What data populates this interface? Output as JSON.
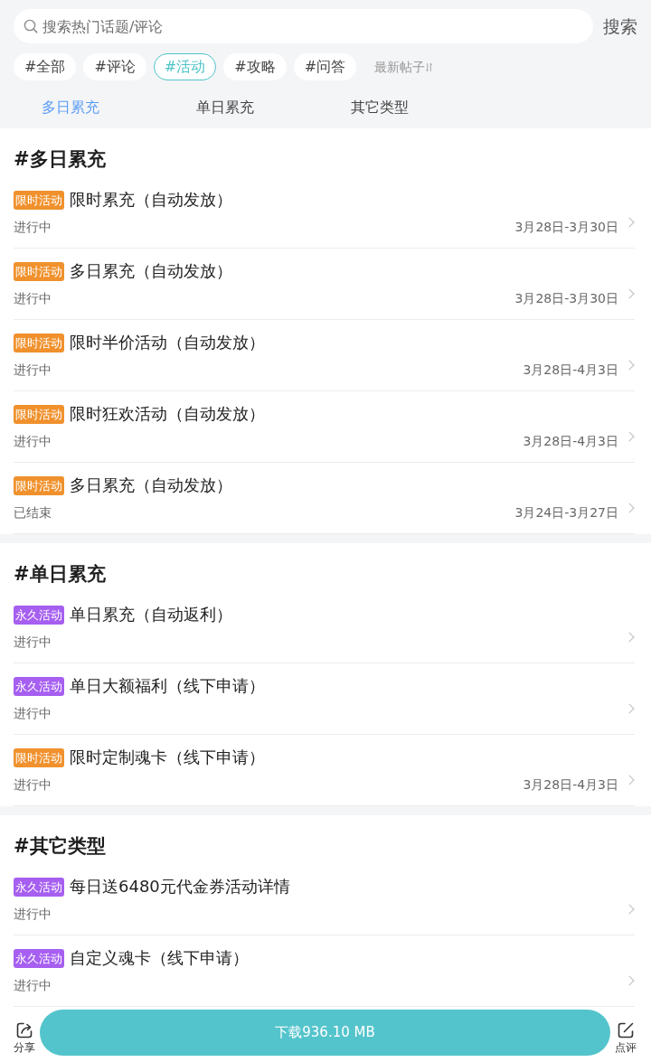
{
  "search": {
    "placeholder": "搜索热门话题/评论",
    "button": "搜索"
  },
  "filters": [
    {
      "label": "#全部",
      "selected": false
    },
    {
      "label": "#评论",
      "selected": false
    },
    {
      "label": "#活动",
      "selected": true
    },
    {
      "label": "#攻略",
      "selected": false
    },
    {
      "label": "#问答",
      "selected": false
    }
  ],
  "sort": {
    "label": "最新帖子"
  },
  "tabs": [
    {
      "label": "多日累充",
      "selected": true
    },
    {
      "label": "单日累充",
      "selected": false
    },
    {
      "label": "其它类型",
      "selected": false
    }
  ],
  "sections": [
    {
      "title": "#多日累充",
      "items": [
        {
          "tag": {
            "label": "限时活动",
            "color": "#f0912d"
          },
          "title": "限时累充（自动发放）",
          "status": "进行中",
          "dates": "3月28日-3月30日"
        },
        {
          "tag": {
            "label": "限时活动",
            "color": "#f0912d"
          },
          "title": "多日累充（自动发放）",
          "status": "进行中",
          "dates": "3月28日-3月30日"
        },
        {
          "tag": {
            "label": "限时活动",
            "color": "#f0912d"
          },
          "title": "限时半价活动（自动发放）",
          "status": "进行中",
          "dates": "3月28日-4月3日"
        },
        {
          "tag": {
            "label": "限时活动",
            "color": "#f0912d"
          },
          "title": "限时狂欢活动（自动发放）",
          "status": "进行中",
          "dates": "3月28日-4月3日"
        },
        {
          "tag": {
            "label": "限时活动",
            "color": "#f0912d"
          },
          "title": "多日累充（自动发放）",
          "status": "已结束",
          "dates": "3月24日-3月27日"
        }
      ]
    },
    {
      "title": "#单日累充",
      "items": [
        {
          "tag": {
            "label": "永久活动",
            "color": "#a65ff0"
          },
          "title": "单日累充（自动返利）",
          "status": "进行中"
        },
        {
          "tag": {
            "label": "永久活动",
            "color": "#a65ff0"
          },
          "title": "单日大额福利（线下申请）",
          "status": "进行中"
        },
        {
          "tag": {
            "label": "限时活动",
            "color": "#f0912d"
          },
          "title": "限时定制魂卡（线下申请）",
          "status": "进行中",
          "dates": "3月28日-4月3日"
        }
      ]
    },
    {
      "title": "#其它类型",
      "items": [
        {
          "tag": {
            "label": "永久活动",
            "color": "#a65ff0"
          },
          "title": "每日送6480元代金券活动详情",
          "status": "进行中"
        },
        {
          "tag": {
            "label": "永久活动",
            "color": "#a65ff0"
          },
          "title": "自定义魂卡（线下申请）",
          "status": "进行中"
        }
      ]
    }
  ],
  "bottom_bar": {
    "share": "分享",
    "download": "下载936.10 MB",
    "review": "点评"
  }
}
